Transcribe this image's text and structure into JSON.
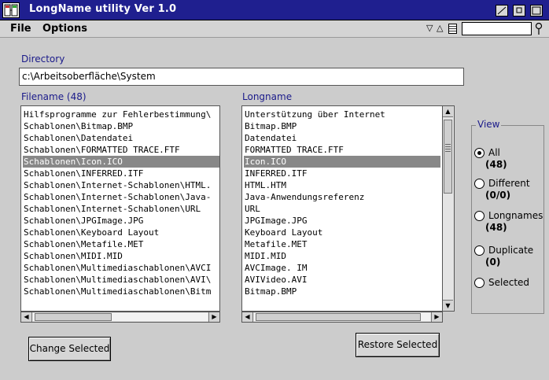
{
  "window": {
    "title": "LongName utility Ver 1.0"
  },
  "menu": {
    "file": "File",
    "options": "Options"
  },
  "toolbar": {
    "nav_down": "▽",
    "nav_up": "△",
    "search_value": ""
  },
  "directory": {
    "label": "Directory",
    "value": "c:\\Arbeitsoberfläche\\System"
  },
  "filename_list": {
    "label": "Filename (48)",
    "selected_index": 4,
    "items": [
      "Hilfsprogramme zur Fehlerbestimmung\\",
      "Schablonen\\Bitmap.BMP",
      "Schablonen\\Datendatei",
      "Schablonen\\FORMATTED TRACE.FTF",
      "Schablonen\\Icon.ICO",
      "Schablonen\\INFERRED.ITF",
      "Schablonen\\Internet-Schablonen\\HTML.",
      "Schablonen\\Internet-Schablonen\\Java-",
      "Schablonen\\Internet-Schablonen\\URL",
      "Schablonen\\JPGImage.JPG",
      "Schablonen\\Keyboard Layout",
      "Schablonen\\Metafile.MET",
      "Schablonen\\MIDI.MID",
      "Schablonen\\Multimediaschablonen\\AVCI",
      "Schablonen\\Multimediaschablonen\\AVI\\",
      "Schablonen\\Multimediaschablonen\\Bitm"
    ]
  },
  "longname_list": {
    "label": "Longname",
    "selected_index": 4,
    "items": [
      "Unterstützung über Internet",
      "Bitmap.BMP",
      "Datendatei",
      "FORMATTED TRACE.FTF",
      "Icon.ICO",
      "INFERRED.ITF",
      "HTML.HTM",
      "Java-Anwendungsreferenz",
      "URL",
      "JPGImage.JPG",
      "Keyboard Layout",
      "Metafile.MET",
      "MIDI.MID",
      "AVCImage. IM",
      "AVIVideo.AVI",
      "Bitmap.BMP"
    ]
  },
  "view": {
    "label": "View",
    "options": [
      {
        "label": "All",
        "count": "(48)",
        "checked": true
      },
      {
        "label": "Different",
        "count": "(0/0)",
        "checked": false
      },
      {
        "label": "Longnames",
        "count": "(48)",
        "checked": false
      },
      {
        "label": "Duplicate",
        "count": "(0)",
        "checked": false
      },
      {
        "label": "Selected",
        "count": "",
        "checked": false
      }
    ]
  },
  "buttons": {
    "change": "Change Selected",
    "restore": "Restore Selected"
  },
  "colors": {
    "title_bar": "#1f1f8f",
    "selection": "#888888",
    "label_blue": "#1a1a8a"
  }
}
